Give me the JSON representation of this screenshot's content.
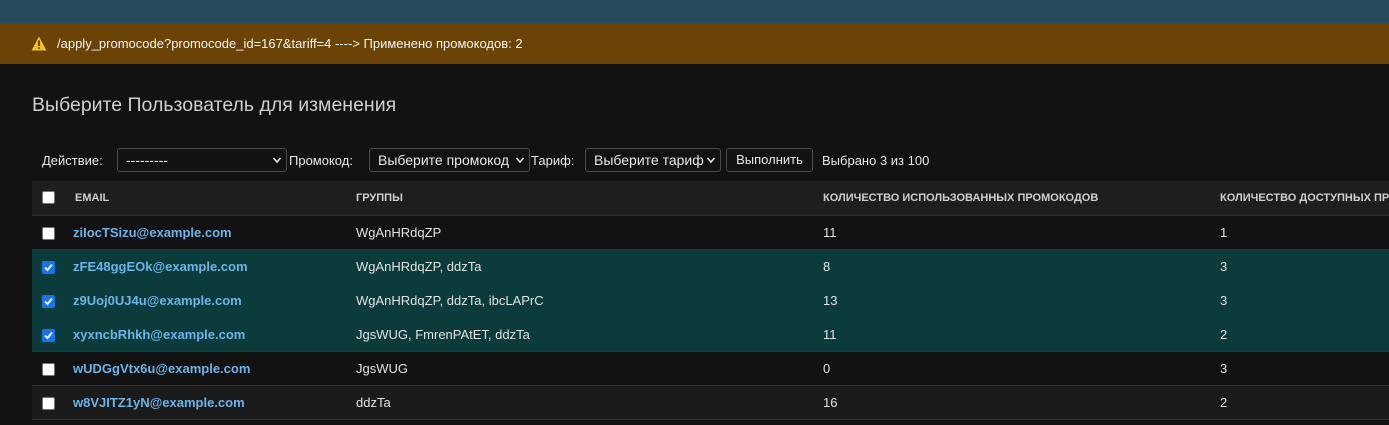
{
  "alert": {
    "icon": "warning-icon",
    "message": "/apply_promocode?promocode_id=167&tariff=4 ----> Применено промокодов: 2"
  },
  "page": {
    "title": "Выберите Пользователь для изменения"
  },
  "actions": {
    "action_label": "Действие:",
    "action_value": "---------",
    "promocode_label": "Промокод:",
    "promocode_value": "Выберите промокод",
    "tariff_label": "Тариф:",
    "tariff_value": "Выберите тариф",
    "submit_label": "Выполнить",
    "selection_counter": "Выбрано 3 из 100"
  },
  "table": {
    "columns": {
      "email": "EMAIL",
      "groups": "ГРУППЫ",
      "used": "КОЛИЧЕСТВО ИСПОЛЬЗОВАННЫХ ПРОМОКОДОВ",
      "available": "КОЛИЧЕСТВО ДОСТУПНЫХ ПРОМОКОДОВ"
    },
    "rows": [
      {
        "checked": false,
        "email": "ziIocTSizu@example.com",
        "groups": "WgAnHRdqZP",
        "used": "11",
        "available": "1"
      },
      {
        "checked": true,
        "email": "zFE48ggEOk@example.com",
        "groups": "WgAnHRdqZP, ddzTa",
        "used": "8",
        "available": "3"
      },
      {
        "checked": true,
        "email": "z9Uoj0UJ4u@example.com",
        "groups": "WgAnHRdqZP, ddzTa, ibcLAPrC",
        "used": "13",
        "available": "3"
      },
      {
        "checked": true,
        "email": "xyxncbRhkh@example.com",
        "groups": "JgsWUG, FmrenPAtET, ddzTa",
        "used": "11",
        "available": "2"
      },
      {
        "checked": false,
        "email": "wUDGgVtx6u@example.com",
        "groups": "JgsWUG",
        "used": "0",
        "available": "3"
      },
      {
        "checked": false,
        "email": "w8VJITZ1yN@example.com",
        "groups": "ddzTa",
        "used": "16",
        "available": "2"
      }
    ]
  }
}
